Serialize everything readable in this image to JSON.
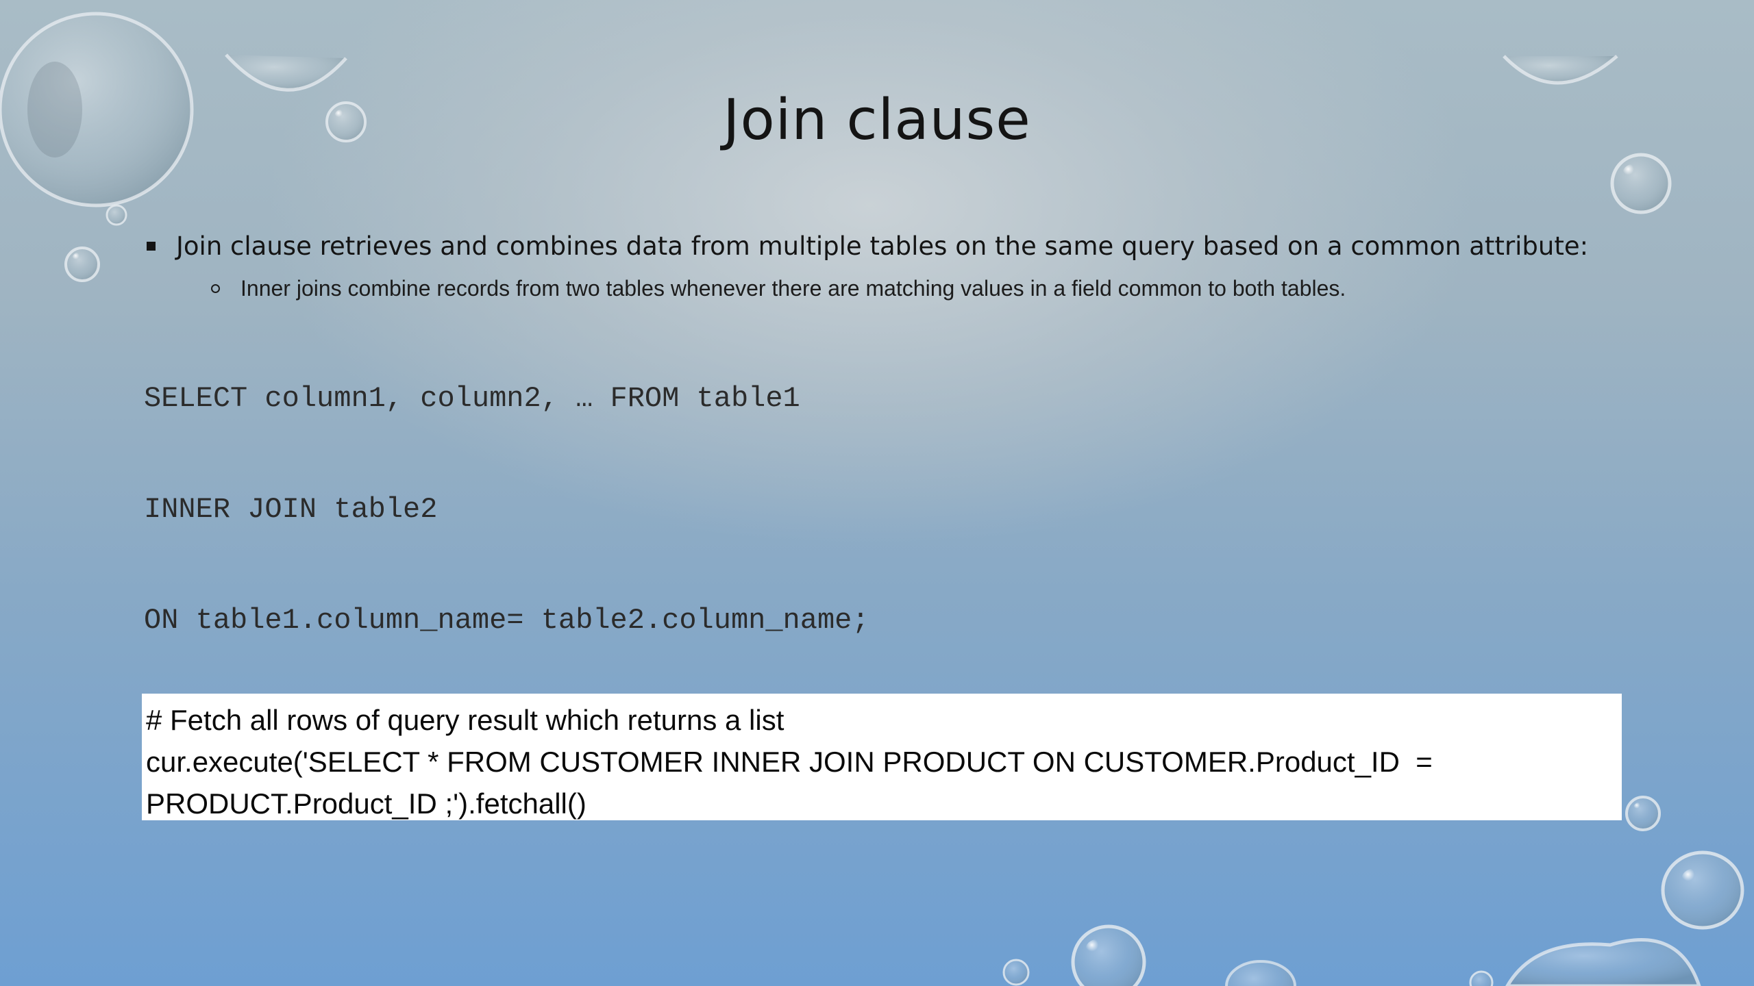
{
  "slide": {
    "title": "Join clause",
    "bullets": [
      {
        "text": "Join clause retrieves and combines data from multiple tables on the same query based on a common attribute:",
        "sub": [
          "Inner joins combine records from two tables whenever there are matching values in a field common to both tables."
        ]
      }
    ],
    "sql_lines": [
      "SELECT column1, column2, … FROM table1",
      "INNER JOIN table2",
      "ON table1.column_name= table2.column_name;"
    ],
    "code_box_lines": [
      "# Fetch all rows of query result which returns a list",
      "cur.execute('SELECT * FROM CUSTOMER INNER JOIN PRODUCT ON CUSTOMER.Product_ID  =",
      "PRODUCT.Product_ID ;').fetchall()"
    ],
    "decoration": "water-droplets-icon"
  }
}
